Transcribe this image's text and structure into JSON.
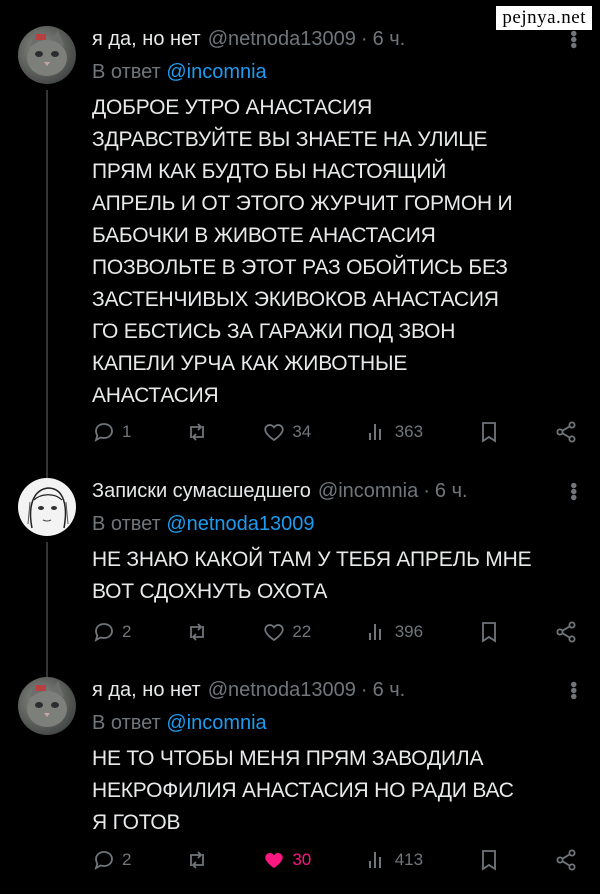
{
  "watermark": "pejnya.net",
  "tweets": [
    {
      "name": "я да, но нет",
      "handle": "@netnoda13009",
      "time": "6 ч.",
      "reply_label": "В ответ",
      "reply_to": "@incomnia",
      "avatar": "cat-avatar",
      "text": "ДОБРОЕ УТРО АНАСТАСИЯ\nЗДРАВСТВУЙТЕ ВЫ ЗНАЕТЕ НА УЛИЦЕ\nПРЯМ КАК БУДТО БЫ НАСТОЯЩИЙ\nАПРЕЛЬ И ОТ ЭТОГО ЖУРЧИТ ГОРМОН И\nБАБОЧКИ В ЖИВОТЕ АНАСТАСИЯ\nПОЗВОЛЬТЕ В ЭТОТ РАЗ ОБОЙТИСЬ БЕЗ\nЗАСТЕНЧИВЫХ ЭКИВОКОВ  АНАСТАСИЯ\nГО ЕБСТИСЬ ЗА ГАРАЖИ ПОД ЗВОН\nКАПЕЛИ УРЧА КАК ЖИВОТНЫЕ\nАНАСТАСИЯ",
      "replies": "1",
      "likes": "34",
      "views": "363",
      "liked": false
    },
    {
      "name": "Записки сумасшедшего",
      "handle": "@incomnia",
      "time": "6 ч.",
      "reply_label": "В ответ",
      "reply_to": "@netnoda13009",
      "avatar": "sketch-avatar",
      "text": "НЕ ЗНАЮ КАКОЙ ТАМ У ТЕБЯ АПРЕЛЬ МНЕ\nВОТ СДОХНУТЬ ОХОТА",
      "replies": "2",
      "likes": "22",
      "views": "396",
      "liked": false
    },
    {
      "name": "я да, но нет",
      "handle": "@netnoda13009",
      "time": "6 ч.",
      "reply_label": "В ответ",
      "reply_to": "@incomnia",
      "avatar": "cat-avatar",
      "text": "НЕ ТО ЧТОБЫ МЕНЯ ПРЯМ ЗАВОДИЛА\nНЕКРОФИЛИЯ АНАСТАСИЯ НО РАДИ ВАС\nЯ ГОТОВ",
      "replies": "2",
      "likes": "30",
      "views": "413",
      "liked": true
    }
  ],
  "colors": {
    "background": "#000000",
    "text": "#e7e9ea",
    "muted": "#71767b",
    "link": "#1d9bf0",
    "like": "#f91880"
  }
}
